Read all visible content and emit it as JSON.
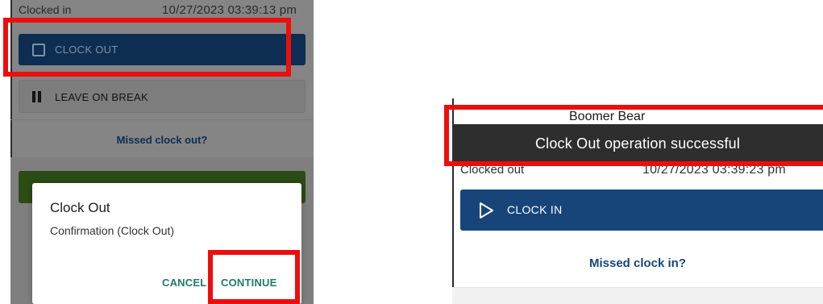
{
  "left_screen": {
    "clocked_in_label": "Clocked in",
    "clocked_in_value": "10/27/2023 03:39:13 pm",
    "clock_out_button": {
      "label": "CLOCK OUT",
      "icon": "checkbox-icon"
    },
    "leave_break_button": {
      "label": "LEAVE ON BREAK",
      "icon": "pause-icon"
    },
    "missed_clock_out_link": "Missed clock out?",
    "dialog": {
      "title": "Clock Out",
      "message": "Confirmation (Clock Out)",
      "cancel_label": "CANCEL",
      "continue_label": "CONTINUE"
    }
  },
  "right_screen": {
    "user_name": "Boomer Bear",
    "toast_message": "Clock Out operation successful",
    "clocked_out_label": "Clocked out",
    "clocked_out_value": "10/27/2023 03:39:23 pm",
    "clock_in_button": {
      "label": "CLOCK IN",
      "icon": "play-icon"
    },
    "missed_clock_in_link": "Missed clock in?"
  },
  "colors": {
    "highlight": "#ee0d0d",
    "primary_blue": "#17457a",
    "dialog_action": "#1f7a6a",
    "toast_bg": "#2e2e2e"
  }
}
